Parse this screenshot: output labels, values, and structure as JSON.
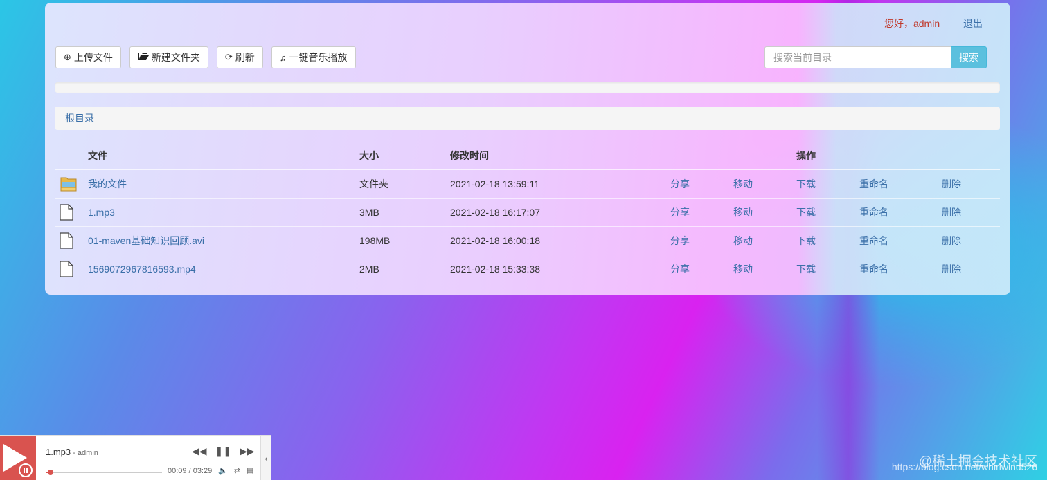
{
  "header": {
    "greeting": "您好，admin",
    "logout_label": "退出"
  },
  "toolbar": {
    "upload_label": "上传文件",
    "newfolder_label": "新建文件夹",
    "refresh_label": "刷新",
    "music_label": "一键音乐播放"
  },
  "search": {
    "placeholder": "搜索当前目录",
    "button_label": "搜索"
  },
  "breadcrumb": {
    "root": "根目录"
  },
  "table": {
    "headers": {
      "file": "文件",
      "size": "大小",
      "modified": "修改时间",
      "actions": "操作"
    },
    "actions": {
      "share": "分享",
      "move": "移动",
      "download": "下载",
      "rename": "重命名",
      "delete": "删除"
    },
    "rows": [
      {
        "icon": "folder-icon",
        "name": "我的文件",
        "size": "文件夹",
        "modified": "2021-02-18 13:59:11"
      },
      {
        "icon": "file-icon",
        "name": "1.mp3",
        "size": "3MB",
        "modified": "2021-02-18 16:17:07"
      },
      {
        "icon": "file-icon",
        "name": "01-maven基础知识回顾.avi",
        "size": "198MB",
        "modified": "2021-02-18 16:00:18"
      },
      {
        "icon": "file-icon",
        "name": "1569072967816593.mp4",
        "size": "2MB",
        "modified": "2021-02-18 15:33:38"
      }
    ]
  },
  "player": {
    "title": "1.mp3",
    "author": " - admin",
    "time": "00:09 / 03:29",
    "progress": 0.043
  },
  "watermark": {
    "line1": "@稀土掘金技术社区",
    "line2": "https://blog.csdn.net/whirlwind526"
  },
  "colors": {
    "accent": "#3a6fa8",
    "greeting": "#c0392b",
    "search_button": "#5bc0de",
    "player_cover": "#d9534f"
  }
}
